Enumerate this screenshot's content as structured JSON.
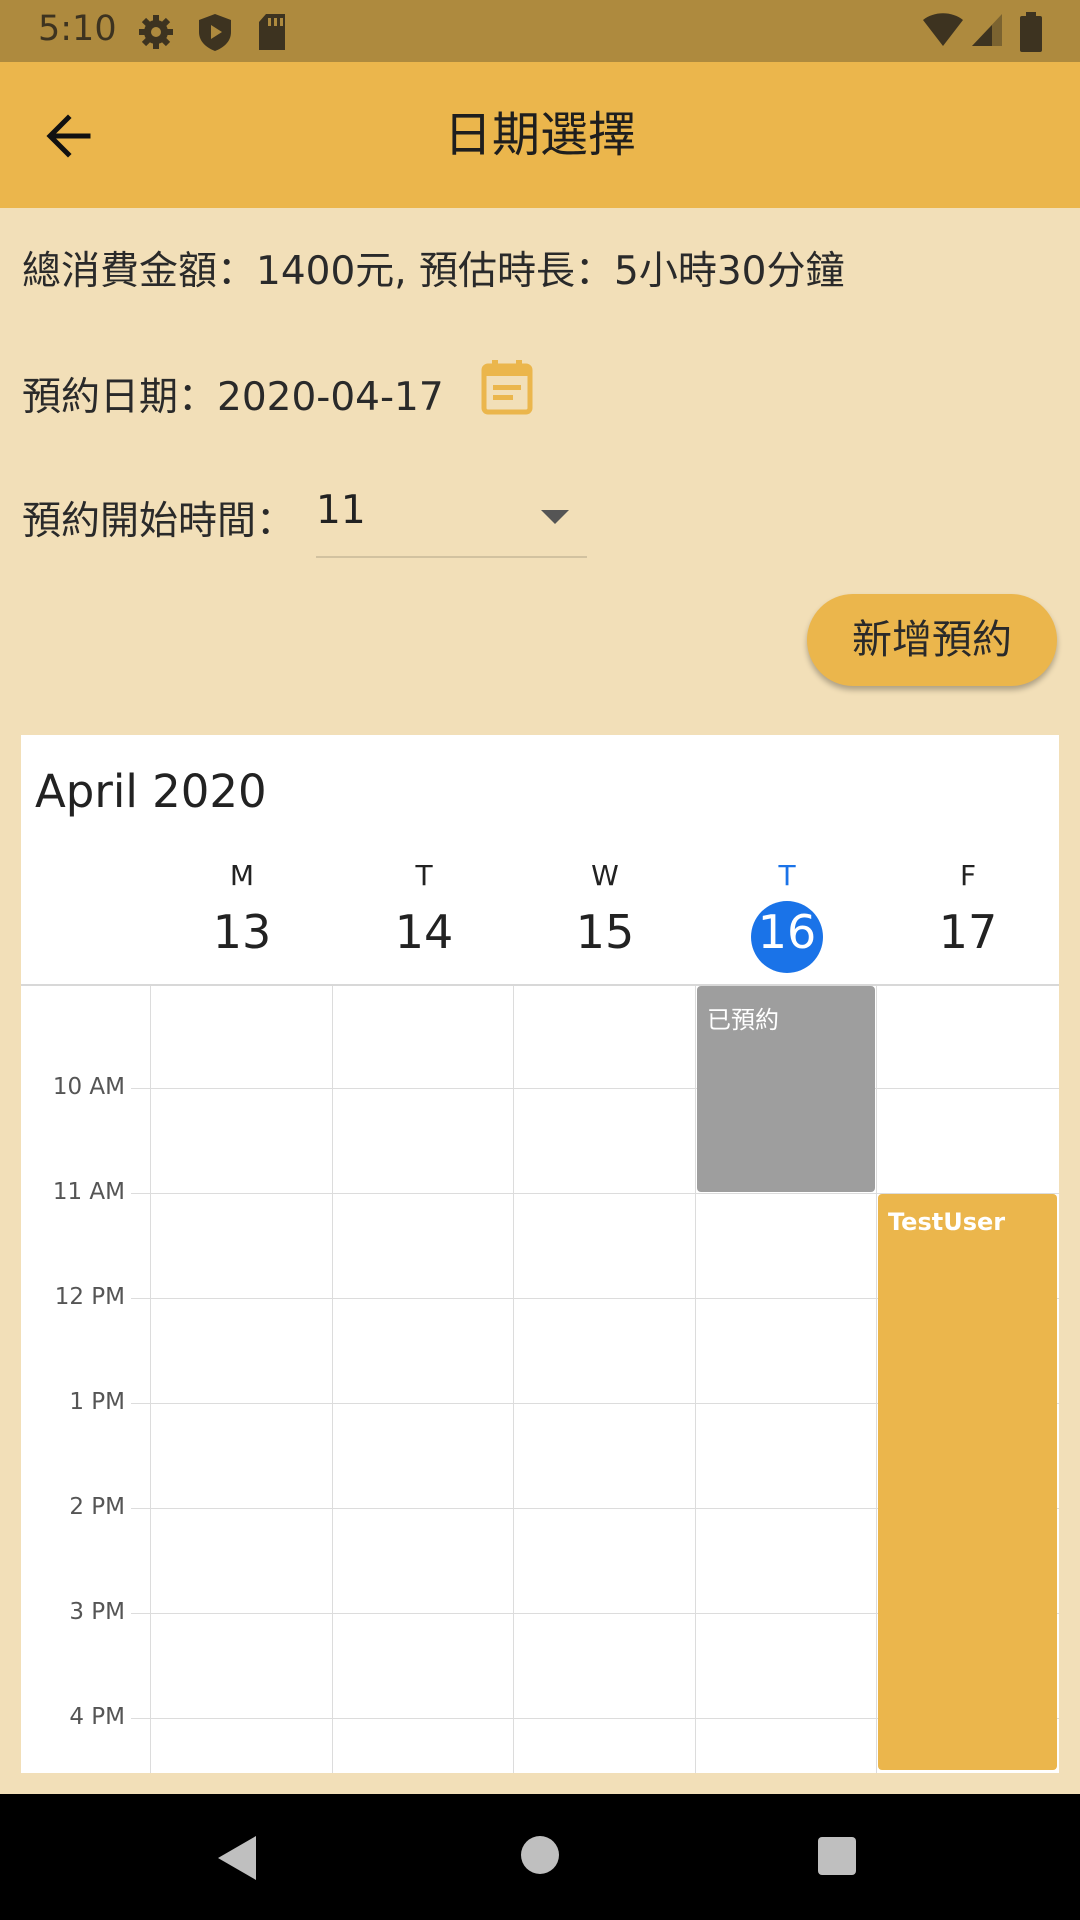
{
  "status_bar": {
    "time": "5:10",
    "icons": [
      "settings-gear-icon",
      "shield-icon",
      "sd-card-icon",
      "wifi-icon",
      "signal-icon",
      "battery-icon"
    ]
  },
  "app_bar": {
    "title": "日期選擇",
    "back_icon": "arrow-back-icon",
    "background": "#ebb64c"
  },
  "summary": {
    "text": "總消費金額：1400元, 預估時長：5小時30分鐘"
  },
  "booking_date": {
    "label": "預約日期：2020-04-17",
    "picker_icon": "calendar-icon"
  },
  "start_time": {
    "label": "預約開始時間：",
    "value": "11"
  },
  "add_button": {
    "label": "新增預約"
  },
  "calendar": {
    "month": "April 2020",
    "days": [
      {
        "letter": "M",
        "number": "13"
      },
      {
        "letter": "T",
        "number": "14"
      },
      {
        "letter": "W",
        "number": "15"
      },
      {
        "letter": "T",
        "number": "16",
        "today": true
      },
      {
        "letter": "F",
        "number": "17"
      }
    ],
    "time_labels": [
      "10 AM",
      "11 AM",
      "12 PM",
      "1 PM",
      "2 PM",
      "3 PM",
      "4 PM"
    ],
    "events": [
      {
        "title": "已預約",
        "color": "#9e9e9e"
      },
      {
        "title": "TestUser",
        "color": "#ebb64c"
      }
    ],
    "today_color": "#1a73e8"
  },
  "nav_bar": {
    "icons": [
      "nav-back-icon",
      "nav-home-icon",
      "nav-recents-icon"
    ]
  }
}
